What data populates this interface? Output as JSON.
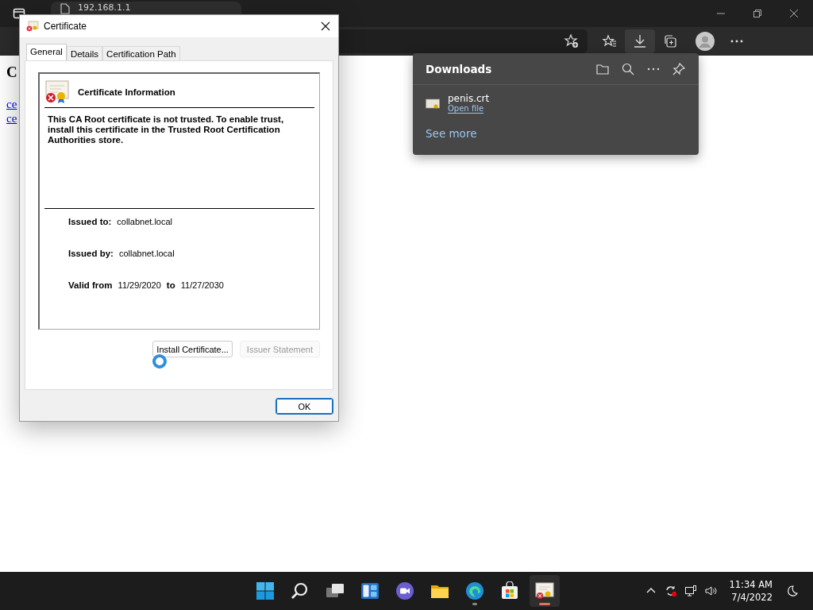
{
  "browser": {
    "tab": {
      "title": "192.168.1.1"
    }
  },
  "page": {
    "heading": "C",
    "links": [
      "ce",
      "ce"
    ]
  },
  "dialog": {
    "title": "Certificate",
    "tabs": [
      {
        "label": "General",
        "selected": true
      },
      {
        "label": "Details",
        "selected": false
      },
      {
        "label": "Certification Path",
        "selected": false
      }
    ],
    "info_title": "Certificate Information",
    "message": "This CA Root certificate is not trusted. To enable trust, install this certificate in the Trusted Root Certification Authorities store.",
    "fields": [
      {
        "label": "Issued to:",
        "value": "collabnet.local"
      },
      {
        "label": "Issued by:",
        "value": "collabnet.local"
      }
    ],
    "validity": {
      "label": "Valid from",
      "from": "11/29/2020",
      "to_label": "to",
      "to": "11/27/2030"
    },
    "buttons": [
      {
        "label": "Install Certificate...",
        "disabled": false
      },
      {
        "label": "Issuer Statement",
        "disabled": true
      }
    ],
    "ok": "OK"
  },
  "downloads": {
    "title": "Downloads",
    "items": [
      {
        "name": "penis.crt",
        "action": "Open file"
      }
    ],
    "see_more": "See more"
  },
  "taskbar": {
    "time": "11:34 AM",
    "date": "7/4/2022"
  }
}
